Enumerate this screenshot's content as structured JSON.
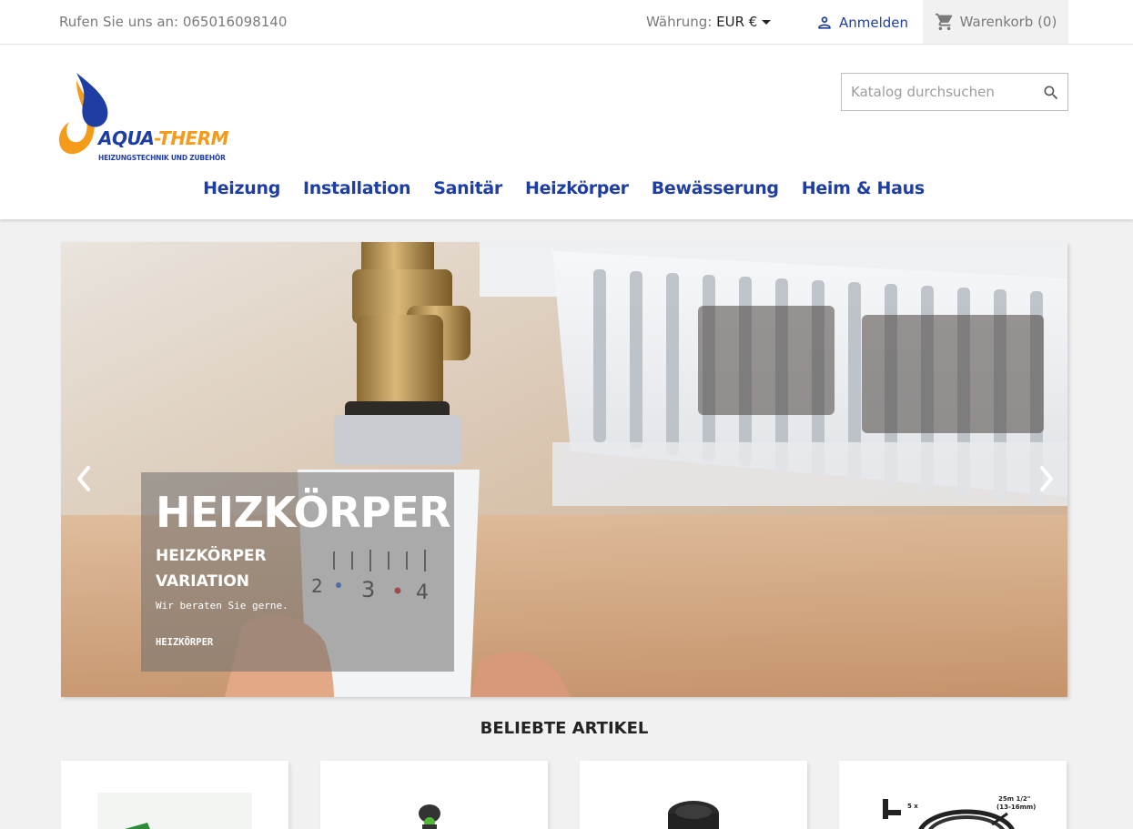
{
  "topbar": {
    "phone": "Rufen Sie uns an: 065016098140",
    "currency_label": "Währung:",
    "currency_value": "EUR €",
    "signin_label": "Anmelden",
    "cart_label": "Warenkorb (0)"
  },
  "brand": {
    "name_part1": "AQUA",
    "name_part2": "-THERM",
    "tagline": "HEIZUNGSTECHNIK UND ZUBEHÖR",
    "colors": {
      "blue": "#1e3ea4",
      "orange": "#f49b1a"
    }
  },
  "search": {
    "placeholder": "Katalog durchsuchen",
    "value": ""
  },
  "nav": {
    "items": [
      {
        "label": "Heizung"
      },
      {
        "label": "Installation"
      },
      {
        "label": "Sanitär"
      },
      {
        "label": "Heizkörper"
      },
      {
        "label": "Bewässerung"
      },
      {
        "label": "Heim & Haus"
      }
    ]
  },
  "slider": {
    "title": "HEIZKÖRPER",
    "subtitle": "HEIZKÖRPER VARIATION",
    "text": "Wir beraten Sie gerne.",
    "link": "HEIZKÖRPER",
    "dial_numbers": [
      "2",
      "3",
      "4"
    ]
  },
  "featured": {
    "title": "BELIEBTE ARTIKEL",
    "product_labels": [
      "5 x",
      "25m 1/2\"",
      "(13-16mm)"
    ]
  },
  "icons": {
    "signin": "person-icon",
    "cart": "cart-icon",
    "search": "search-icon",
    "slider_prev": "chevron-left-icon",
    "slider_next": "chevron-right-icon"
  }
}
